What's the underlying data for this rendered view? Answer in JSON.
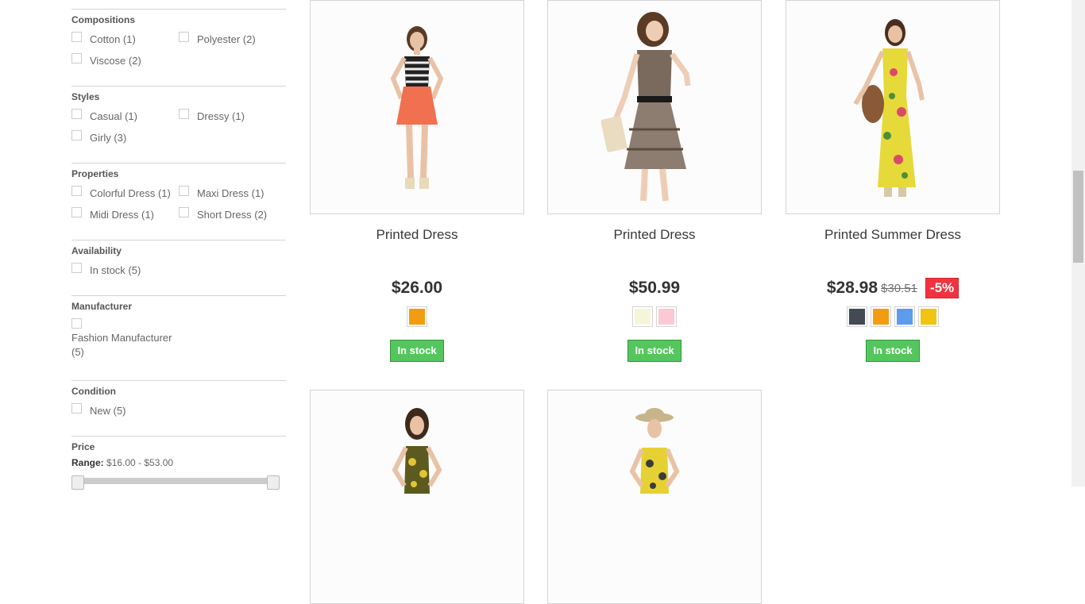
{
  "filters": {
    "compositions": {
      "title": "Compositions",
      "options": [
        "Cotton (1)",
        "Polyester (2)",
        "Viscose (2)"
      ]
    },
    "styles": {
      "title": "Styles",
      "options": [
        "Casual (1)",
        "Dressy (1)",
        "Girly (3)"
      ]
    },
    "properties": {
      "title": "Properties",
      "options": [
        "Colorful Dress (1)",
        "Maxi Dress (1)",
        "Midi Dress (1)",
        "Short Dress (2)"
      ]
    },
    "availability": {
      "title": "Availability",
      "options": [
        "In stock (5)"
      ]
    },
    "manufacturer": {
      "title": "Manufacturer",
      "option_name": "Fashion Manufacturer",
      "option_count": "(5)"
    },
    "condition": {
      "title": "Condition",
      "options": [
        "New (5)"
      ]
    },
    "price": {
      "title": "Price",
      "range_label": "Range:",
      "range_value": "$16.00 - $53.00"
    }
  },
  "products": [
    {
      "name": "Printed Dress",
      "price": "$26.00",
      "colors": [
        "#f39c11"
      ],
      "stock": "In stock"
    },
    {
      "name": "Printed Dress",
      "price": "$50.99",
      "colors": [
        "#f5f5dc",
        "#fcc8d1"
      ],
      "stock": "In stock"
    },
    {
      "name": "Printed Summer Dress",
      "price": "$28.98",
      "old_price": "$30.51",
      "discount": "-5%",
      "colors": [
        "#434a54",
        "#f39c11",
        "#5d9cec",
        "#f1c40f"
      ],
      "stock": "In stock"
    }
  ]
}
